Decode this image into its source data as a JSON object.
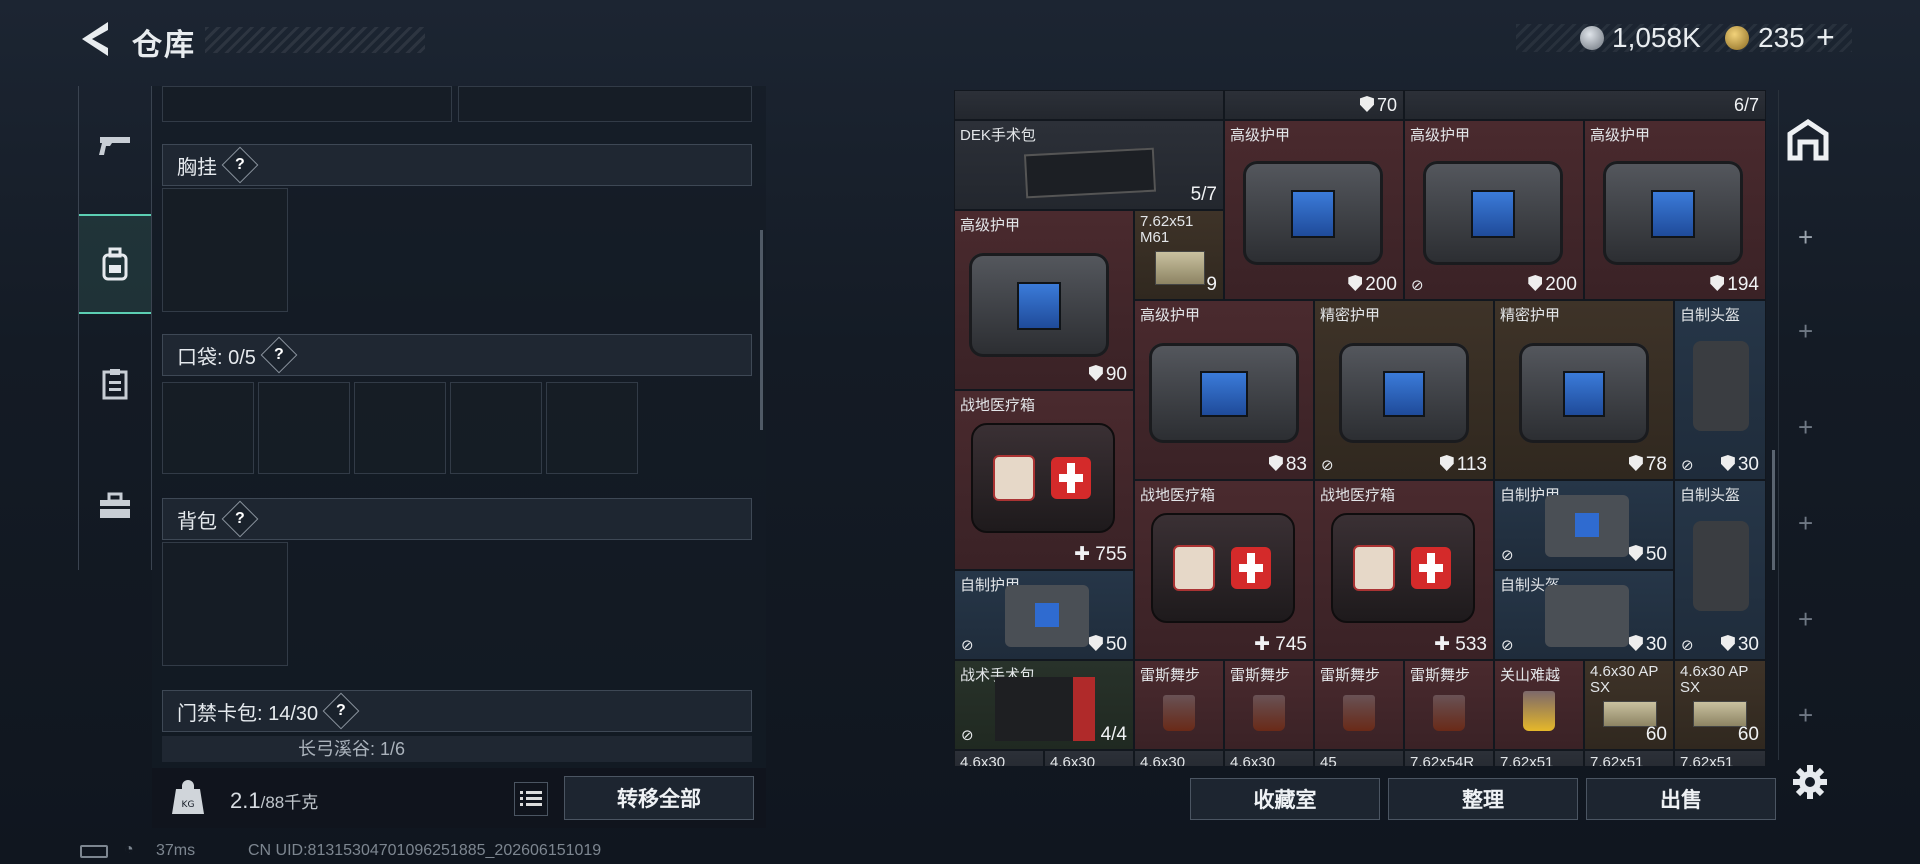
{
  "header": {
    "title": "仓库"
  },
  "currency": {
    "silver": "1,058K",
    "gold": "235"
  },
  "left_panel": {
    "chest": {
      "label": "胸挂",
      "help": "?"
    },
    "pockets": {
      "label": "口袋: 0/5",
      "help": "?"
    },
    "backpack": {
      "label": "背包",
      "help": "?"
    },
    "keycard": {
      "label": "门禁卡包: 14/30",
      "help": "?",
      "sub_label": "长弓溪谷: 1/6"
    },
    "weight": {
      "value": "2.1",
      "unit": "/88千克"
    },
    "transfer_all": "转移全部"
  },
  "stash": {
    "top_row": [
      {
        "value": "70"
      },
      {
        "value": "6/7"
      }
    ],
    "items": [
      {
        "name": "DEK手术包",
        "value": "5/7"
      },
      {
        "name": "高级护甲",
        "value": ""
      },
      {
        "name": "高级护甲",
        "value": ""
      },
      {
        "name": "高级护甲",
        "value": ""
      },
      {
        "name": "高级护甲",
        "value": "90"
      },
      {
        "name": "7.62x51 M61",
        "value": "9"
      },
      {
        "name": "",
        "value": "200"
      },
      {
        "name": "",
        "value": "200"
      },
      {
        "name": "",
        "value": "194"
      },
      {
        "name": "高级护甲",
        "value": "83"
      },
      {
        "name": "精密护甲",
        "value": "113"
      },
      {
        "name": "精密护甲",
        "value": "78"
      },
      {
        "name": "自制头盔",
        "value": "30"
      },
      {
        "name": "战地医疗箱",
        "value": "755"
      },
      {
        "name": "战地医疗箱",
        "value": "745"
      },
      {
        "name": "战地医疗箱",
        "value": "533"
      },
      {
        "name": "自制护甲",
        "value": "50"
      },
      {
        "name": "自制头盔",
        "value": "30"
      },
      {
        "name": "自制护甲",
        "value": "50"
      },
      {
        "name": "自制头盔",
        "value": "30"
      },
      {
        "name": "战术手术包",
        "value": "4/4"
      },
      {
        "name": "雷斯舞步",
        "value": ""
      },
      {
        "name": "雷斯舞步",
        "value": ""
      },
      {
        "name": "雷斯舞步",
        "value": ""
      },
      {
        "name": "雷斯舞步",
        "value": ""
      },
      {
        "name": "关山难越",
        "value": ""
      },
      {
        "name": "4.6x30 AP SX",
        "value": "60"
      },
      {
        "name": "4.6x30 AP SX",
        "value": "60"
      }
    ],
    "bottom_peek": [
      "4.6x30",
      "4.6x30",
      "4.6x30",
      "4.6x30",
      "45",
      "7.62x54R",
      "7.62x51",
      "7.62x51",
      "7.62x51"
    ]
  },
  "buttons": {
    "collection": "收藏室",
    "sort": "整理",
    "sell": "出售"
  },
  "status": {
    "ping": "37ms",
    "uid": "CN UID:81315304701096251885_202606151019"
  }
}
